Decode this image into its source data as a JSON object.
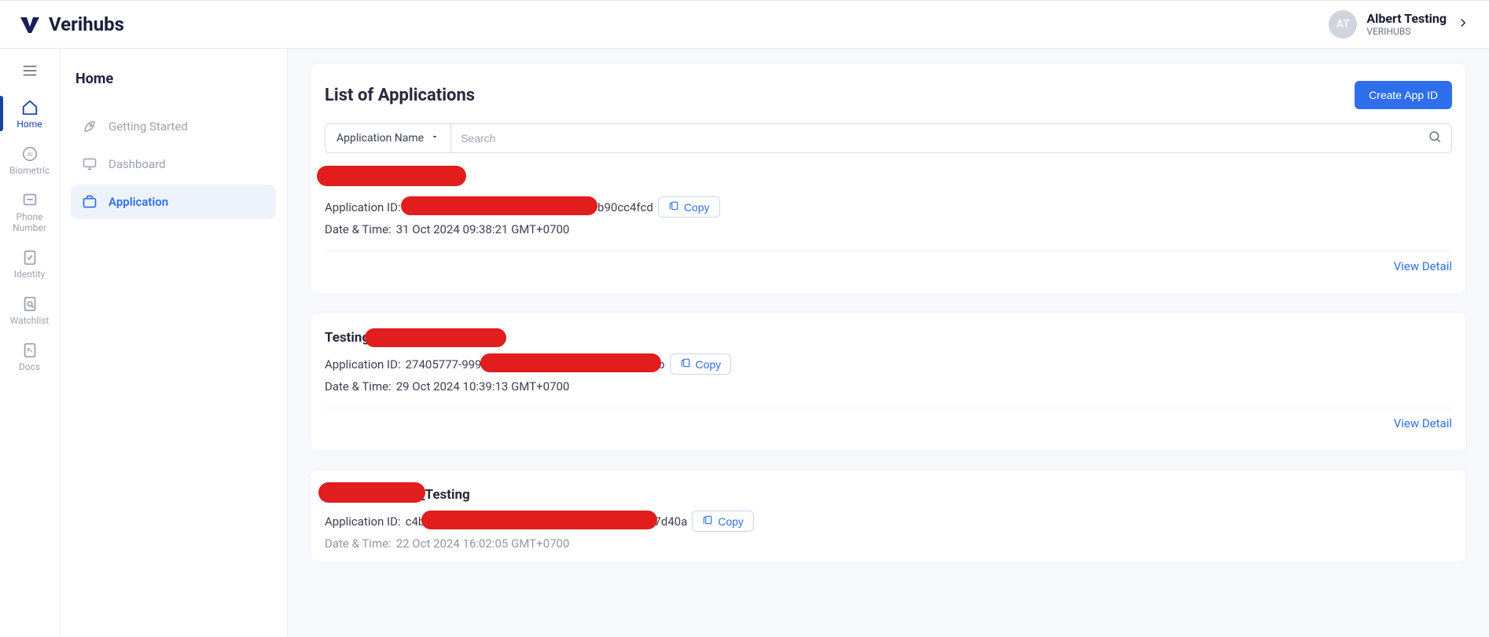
{
  "header": {
    "brand": "Verihubs",
    "user_name": "Albert Testing",
    "user_org": "VERIHUBS",
    "avatar_initials": "AT"
  },
  "rail": {
    "items": [
      {
        "label": "Home",
        "icon": "home-icon",
        "active": true
      },
      {
        "label": "Biometric",
        "icon": "biometric-icon",
        "active": false
      },
      {
        "label": "Phone Number",
        "icon": "phone-icon",
        "active": false
      },
      {
        "label": "Identity",
        "icon": "identity-icon",
        "active": false
      },
      {
        "label": "Watchlist",
        "icon": "watchlist-icon",
        "active": false
      },
      {
        "label": "Docs",
        "icon": "docs-icon",
        "active": false
      }
    ]
  },
  "secondary": {
    "title": "Home",
    "items": [
      {
        "label": "Getting Started",
        "icon": "rocket-icon",
        "active": false
      },
      {
        "label": "Dashboard",
        "icon": "monitor-icon",
        "active": false
      },
      {
        "label": "Application",
        "icon": "briefcase-icon",
        "active": true
      }
    ]
  },
  "main": {
    "title": "List of Applications",
    "create_button": "Create App ID",
    "filter_label": "Application Name",
    "search_placeholder": "Search",
    "copy_label": "Copy",
    "view_detail_label": "View Detail",
    "app_id_label": "Application ID:",
    "datetime_label": "Date & Time:",
    "apps": [
      {
        "name_prefix": "",
        "name_suffix": "",
        "id_visible_suffix": "6b90cc4fcd",
        "datetime": "31 Oct 2024 09:38:21 GMT+0700"
      },
      {
        "name_prefix": "Testing_",
        "name_suffix": "",
        "id_prefix": "27405777-9995-",
        "id_visible_suffix": "b",
        "datetime": "29 Oct 2024 10:39:13 GMT+0700"
      },
      {
        "name_prefix": "",
        "name_suffix": "_Testing",
        "id_prefix": "c4b",
        "id_visible_suffix": "7d40a",
        "datetime": "22 Oct 2024 16:02:05 GMT+0700"
      }
    ]
  }
}
